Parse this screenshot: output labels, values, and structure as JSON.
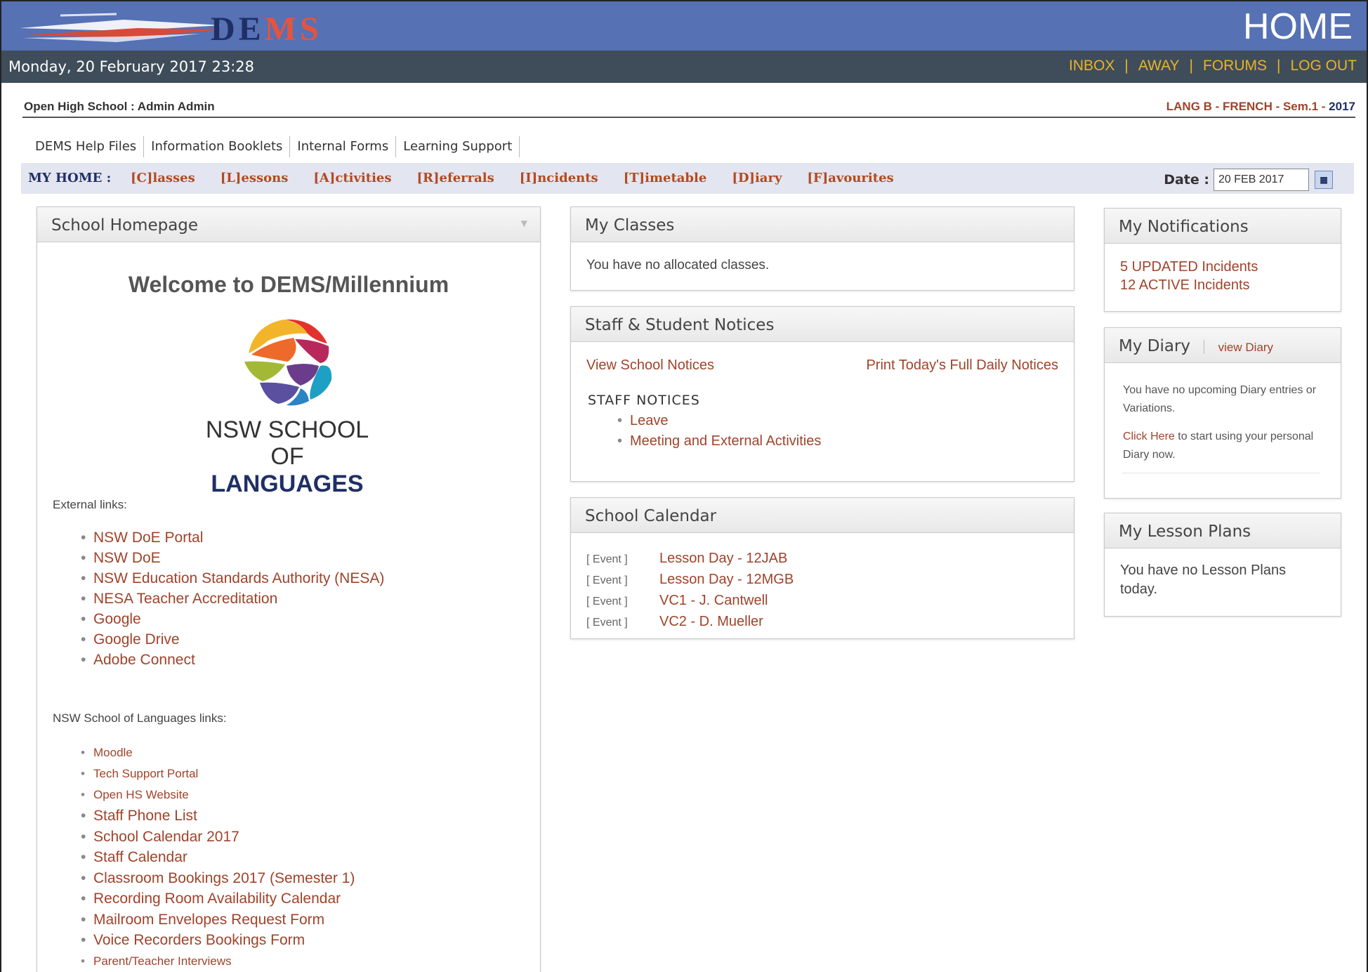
{
  "header": {
    "brand_prefix": "DE",
    "brand_suffix": "MS",
    "page_title": "HOME"
  },
  "datebar": {
    "datetime": "Monday, 20 February 2017 23:28",
    "links": [
      "INBOX",
      "AWAY",
      "FORUMS",
      "LOG OUT"
    ],
    "separator": "|"
  },
  "school": {
    "name": "Open High School : Admin Admin",
    "course": "LANG B - FRENCH - Sem.1 - ",
    "year": "2017"
  },
  "tabs": [
    "DEMS Help Files",
    "Information Booklets",
    "Internal Forms",
    "Learning Support"
  ],
  "nav": {
    "label": "MY HOME :",
    "items": [
      "[C]lasses",
      "[L]essons",
      "[A]ctivities",
      "[R]eferrals",
      "[I]ncidents",
      "[T]imetable",
      "[D]iary",
      "[F]avourites"
    ],
    "date_label": "Date :",
    "date_value": "20 FEB 2017"
  },
  "home_panel": {
    "title": "School Homepage",
    "welcome": "Welcome to DEMS/Millennium",
    "logo_line1": "NSW SCHOOL",
    "logo_line2_a": "OF ",
    "logo_line2_b": "LANGUAGES",
    "external_label": "External links:",
    "external_links": [
      "NSW DoE Portal",
      "NSW DoE",
      "NSW Education Standards Authority (NESA)",
      "NESA Teacher Accreditation",
      "Google",
      "Google Drive",
      "Adobe Connect"
    ],
    "nsw_label": "NSW School of Languages links:",
    "nsw_links": [
      "Moodle",
      "Tech Support Portal",
      "Open HS Website",
      "Staff Phone List",
      "School Calendar 2017",
      "Staff Calendar",
      "Classroom Bookings 2017 (Semester 1)",
      "Recording Room Availability Calendar",
      "Mailroom Envelopes Request Form",
      "Voice Recorders Bookings Form",
      "Parent/Teacher Interviews"
    ]
  },
  "classes_panel": {
    "title": "My Classes",
    "text": "You have no allocated classes."
  },
  "notices_panel": {
    "title": "Staff & Student Notices",
    "view_link": "View School Notices",
    "print_link": "Print Today's Full Daily Notices",
    "staff_heading": "STAFF NOTICES",
    "items": [
      "Leave",
      "Meeting and External Activities"
    ]
  },
  "calendar_panel": {
    "title": "School Calendar",
    "tag": "[ Event ]",
    "events": [
      "Lesson Day - 12JAB",
      "Lesson Day - 12MGB",
      "VC1 - J. Cantwell",
      "VC2 - D. Mueller"
    ]
  },
  "notif_panel": {
    "title": "My Notifications",
    "items": [
      "5 UPDATED Incidents",
      "12 ACTIVE Incidents"
    ]
  },
  "diary_panel": {
    "title": "My Diary",
    "view_link": "view Diary",
    "text1": "You have no upcoming Diary entries or Variations.",
    "click_here": "Click Here",
    "text2": " to start using your personal Diary now."
  },
  "lesson_panel": {
    "title": "My Lesson Plans",
    "text": "You have no Lesson Plans today."
  },
  "colors": {
    "header_blue": "#5671b4",
    "date_bar": "#3f4d5a",
    "link_rust": "#a0432a",
    "nav_bg": "#e3e5f1",
    "top_links": "#e8b325"
  }
}
